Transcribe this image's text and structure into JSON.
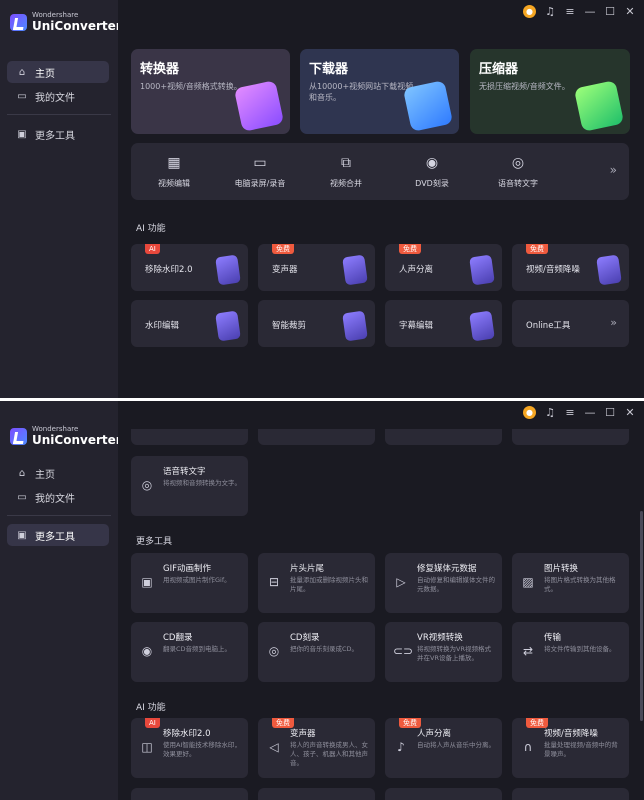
{
  "app": {
    "brand_small": "Wondershare",
    "brand_name": "UniConverter"
  },
  "sidebar": {
    "items": [
      {
        "label": "主页",
        "icon": "home-icon"
      },
      {
        "label": "我的文件",
        "icon": "folder-icon"
      },
      {
        "label": "更多工具",
        "icon": "toolbox-icon"
      }
    ]
  },
  "window1": {
    "cards": [
      {
        "title": "转换器",
        "desc": "1000+视频/音频格式转换。",
        "color": "#3a3547"
      },
      {
        "title": "下载器",
        "desc": "从10000+视频网站下载视频和音乐。",
        "color": "#2f3550"
      },
      {
        "title": "压缩器",
        "desc": "无损压缩视频/音频文件。",
        "color": "#26352c"
      }
    ],
    "quick_tools": [
      {
        "label": "视频编辑",
        "icon": "film-icon"
      },
      {
        "label": "电脑录屏/录音",
        "icon": "screen-record-icon"
      },
      {
        "label": "视频合并",
        "icon": "merge-icon"
      },
      {
        "label": "DVD刻录",
        "icon": "disc-icon"
      },
      {
        "label": "语音转文字",
        "icon": "speech-icon"
      }
    ],
    "ai_section_title": "AI 功能",
    "ai_cards": [
      {
        "label": "移除水印2.0",
        "badge": "AI"
      },
      {
        "label": "变声器",
        "badge": "免费"
      },
      {
        "label": "人声分离",
        "badge": "免费"
      },
      {
        "label": "视频/音频降噪",
        "badge": "免费"
      },
      {
        "label": "水印编辑",
        "badge": ""
      },
      {
        "label": "智能裁剪",
        "badge": ""
      },
      {
        "label": "字幕编辑",
        "badge": ""
      },
      {
        "label": "Online工具",
        "badge": ""
      }
    ]
  },
  "window2": {
    "speech_card": {
      "title": "语音转文字",
      "desc": "将视频和音频转换为文字。"
    },
    "more_tools_title": "更多工具",
    "more_tools": [
      {
        "title": "GIF动画制作",
        "desc": "用视频或图片制作Gif。",
        "icon": "gif-icon"
      },
      {
        "title": "片头片尾",
        "desc": "批量添加或删除视频片头和片尾。",
        "icon": "intro-outro-icon"
      },
      {
        "title": "修复媒体元数据",
        "desc": "自动修复和编辑媒体文件的元数据。",
        "icon": "metadata-icon"
      },
      {
        "title": "图片转换",
        "desc": "将图片格式转换为其他格式。",
        "icon": "image-icon"
      },
      {
        "title": "CD翻录",
        "desc": "翻录CD音频到电脑上。",
        "icon": "cd-icon"
      },
      {
        "title": "CD刻录",
        "desc": "把你的音乐刻录成CD。",
        "icon": "cd-burn-icon"
      },
      {
        "title": "VR视频转换",
        "desc": "将视频转换为VR视频格式并在VR设备上播放。",
        "icon": "vr-icon"
      },
      {
        "title": "传输",
        "desc": "将文件传输到其他设备。",
        "icon": "transfer-icon"
      }
    ],
    "ai_section_title": "AI 功能",
    "ai_tools": [
      {
        "title": "移除水印2.0",
        "desc": "使用AI智能技术移除水印，效果更好。",
        "badge": "AI",
        "icon": "watermark-icon"
      },
      {
        "title": "变声器",
        "desc": "将人的声音转换成男人、女人、孩子、机器人和其他声音。",
        "badge": "免费",
        "icon": "voice-icon"
      },
      {
        "title": "人声分离",
        "desc": "自动将人声从音乐中分离。",
        "badge": "免费",
        "icon": "vocal-icon"
      },
      {
        "title": "视频/音频降噪",
        "desc": "批量处理视频/音频中的背景噪声。",
        "badge": "免费",
        "icon": "denoise-icon"
      }
    ]
  }
}
